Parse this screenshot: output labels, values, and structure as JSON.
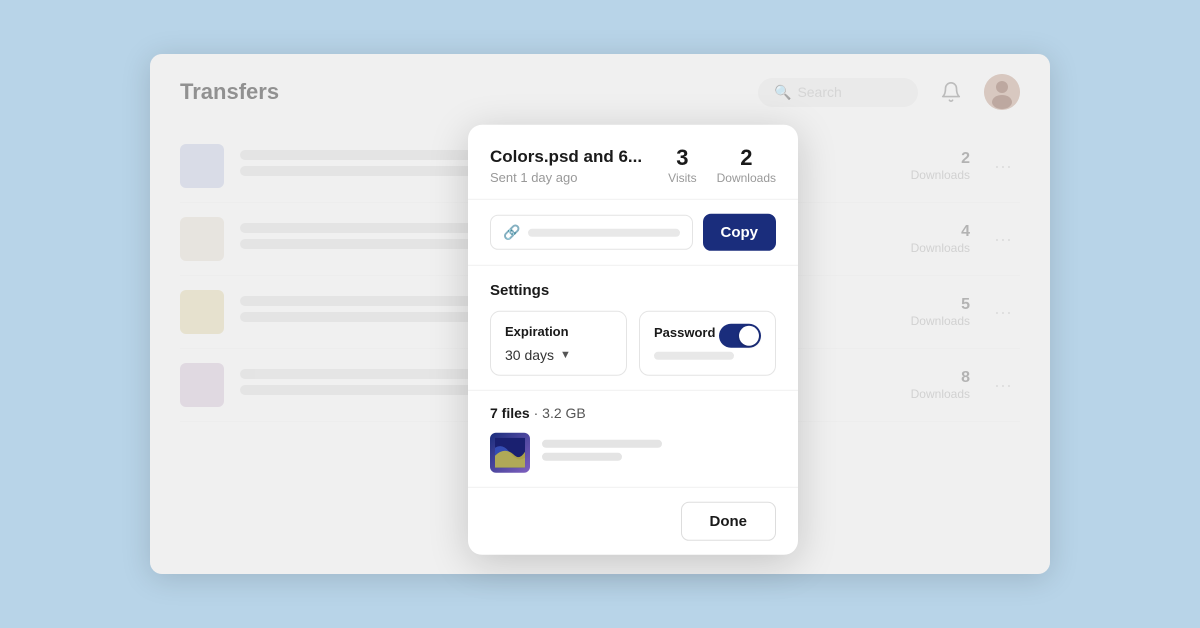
{
  "app": {
    "title": "Transfers",
    "search_placeholder": "Search"
  },
  "modal": {
    "title": "Colors.psd and 6...",
    "subtitle": "Sent 1 day ago",
    "stats": {
      "visits_count": "3",
      "visits_label": "Visits",
      "downloads_count": "2",
      "downloads_label": "Downloads"
    },
    "link_placeholder": "",
    "copy_button": "Copy",
    "settings": {
      "heading": "Settings",
      "expiration_label": "Expiration",
      "expiration_value": "30 days",
      "password_label": "Password"
    },
    "files": {
      "count": "7 files",
      "size": "3.2 GB"
    },
    "done_button": "Done"
  },
  "list": {
    "rows": [
      {
        "downloads": "2",
        "downloads_label": "Downloads"
      },
      {
        "downloads": "4",
        "downloads_label": "Downloads"
      },
      {
        "downloads": "5",
        "downloads_label": "Downloads"
      },
      {
        "downloads": "8",
        "downloads_label": "Downloads"
      }
    ]
  }
}
